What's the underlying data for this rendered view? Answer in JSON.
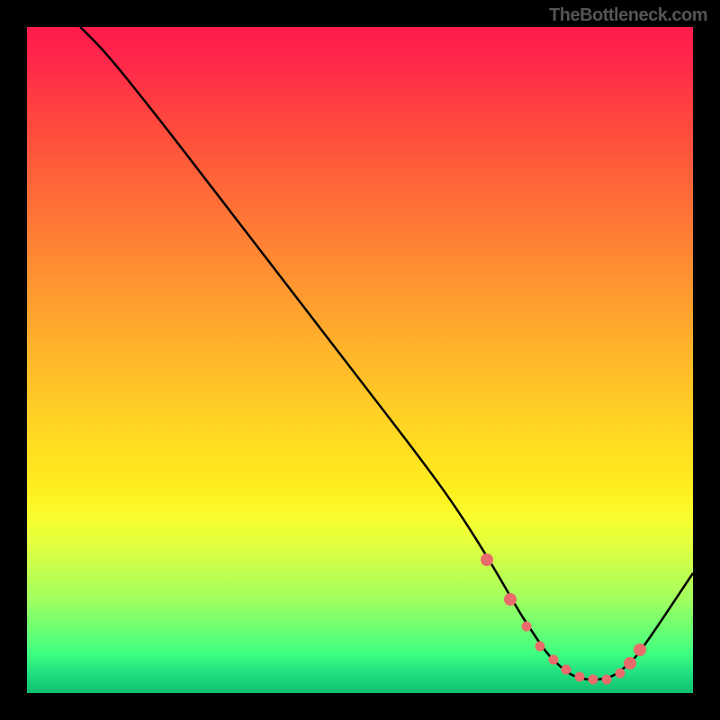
{
  "watermark": "TheBottleneck.com",
  "chart_data": {
    "type": "line",
    "title": "",
    "xlabel": "",
    "ylabel": "",
    "xlim": [
      0,
      100
    ],
    "ylim": [
      0,
      100
    ],
    "series": [
      {
        "name": "curve",
        "x": [
          8,
          12,
          20,
          30,
          40,
          50,
          60,
          65,
          70,
          74,
          76,
          78,
          80,
          82,
          84,
          86,
          88,
          90,
          92,
          100
        ],
        "y": [
          100,
          96,
          86,
          73,
          60,
          47,
          34,
          27,
          19,
          12,
          9,
          6,
          4,
          2.5,
          2,
          2,
          2.5,
          4,
          6,
          18
        ]
      }
    ],
    "dots": {
      "name": "markers",
      "x": [
        69,
        72.5,
        75,
        77,
        79,
        81,
        83,
        85,
        87,
        89,
        90.5,
        92
      ],
      "y": [
        20,
        14,
        10,
        7,
        5,
        3.5,
        2.5,
        2,
        2,
        3,
        4.5,
        6.5
      ]
    },
    "gradient_stops": [
      {
        "pos": 0,
        "color": "#ff1a4d"
      },
      {
        "pos": 50,
        "color": "#ffb82a"
      },
      {
        "pos": 75,
        "color": "#f8ff30"
      },
      {
        "pos": 100,
        "color": "#10c070"
      }
    ]
  }
}
